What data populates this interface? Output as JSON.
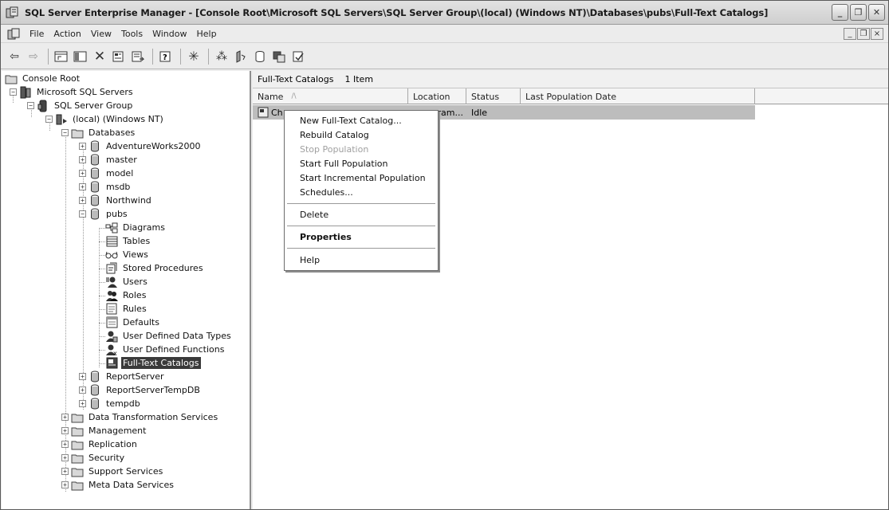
{
  "window": {
    "title": "SQL Server Enterprise Manager - [Console Root\\Microsoft SQL Servers\\SQL Server Group\\(local) (Windows NT)\\Databases\\pubs\\Full-Text Catalogs]",
    "minimize": "_",
    "restore": "❐",
    "close": "✕"
  },
  "menubar": {
    "items": [
      "File",
      "Action",
      "View",
      "Tools",
      "Window",
      "Help"
    ],
    "mdi_minimize": "_",
    "mdi_restore": "❐",
    "mdi_close": "×"
  },
  "toolbar": {
    "icons": [
      "back-icon",
      "forward-icon",
      "up-folder-icon",
      "show-hide-tree-icon",
      "delete-icon",
      "properties-icon",
      "export-list-icon",
      "help-icon",
      "new-object-icon",
      "wizard-icon",
      "server-icon",
      "database-icon",
      "job-icon",
      "register-icon"
    ]
  },
  "tree": {
    "console_root": "Console Root",
    "ms_sql_servers": "Microsoft SQL Servers",
    "server_group": "SQL Server Group",
    "local_server": "(local) (Windows NT)",
    "databases": "Databases",
    "db_adventureworks": "AdventureWorks2000",
    "db_master": "master",
    "db_model": "model",
    "db_msdb": "msdb",
    "db_northwind": "Northwind",
    "db_pubs": "pubs",
    "pubs_diagrams": "Diagrams",
    "pubs_tables": "Tables",
    "pubs_views": "Views",
    "pubs_stored_procedures": "Stored Procedures",
    "pubs_users": "Users",
    "pubs_roles": "Roles",
    "pubs_rules": "Rules",
    "pubs_defaults": "Defaults",
    "pubs_udt": "User Defined Data Types",
    "pubs_udf": "User Defined Functions",
    "pubs_fulltext": "Full-Text Catalogs",
    "db_reportserver": "ReportServer",
    "db_reportservertempdb": "ReportServerTempDB",
    "db_tempdb": "tempdb",
    "dts": "Data Transformation Services",
    "management": "Management",
    "replication": "Replication",
    "security": "Security",
    "support_services": "Support Services",
    "meta_data_services": "Meta Data Services"
  },
  "details": {
    "header_title": "Full-Text Catalogs",
    "header_count": "1 Item",
    "columns": [
      "Name",
      "Location",
      "Status",
      "Last Population Date"
    ],
    "row": {
      "name": "Ch",
      "location": "gram...",
      "status": "Idle",
      "last_population": ""
    }
  },
  "context_menu": {
    "new_catalog": "New Full-Text Catalog...",
    "rebuild": "Rebuild Catalog",
    "stop_population": "Stop Population",
    "start_full": "Start Full Population",
    "start_incremental": "Start Incremental Population",
    "schedules": "Schedules...",
    "delete": "Delete",
    "properties": "Properties",
    "help": "Help"
  }
}
